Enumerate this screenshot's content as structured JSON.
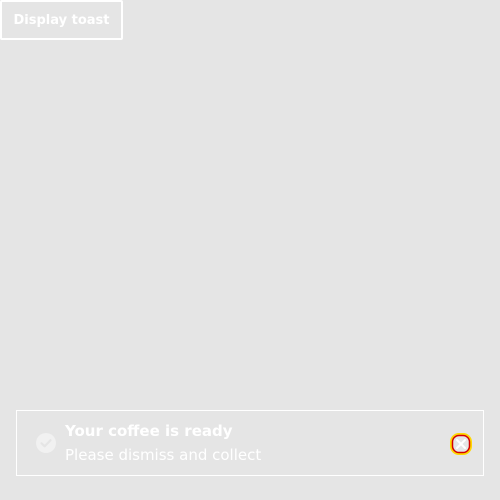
{
  "toolbar": {
    "display_toast_label": "Display toast"
  },
  "toast": {
    "title": "Your coffee is ready",
    "message": "Please dismiss and collect",
    "icon": "check-circle-icon",
    "dismiss_icon": "close-icon"
  },
  "colors": {
    "background": "#e5e5e5",
    "foreground": "#ffffff",
    "focus_outline_outer": "#ffd700",
    "focus_outline_inner": "#d40000"
  }
}
